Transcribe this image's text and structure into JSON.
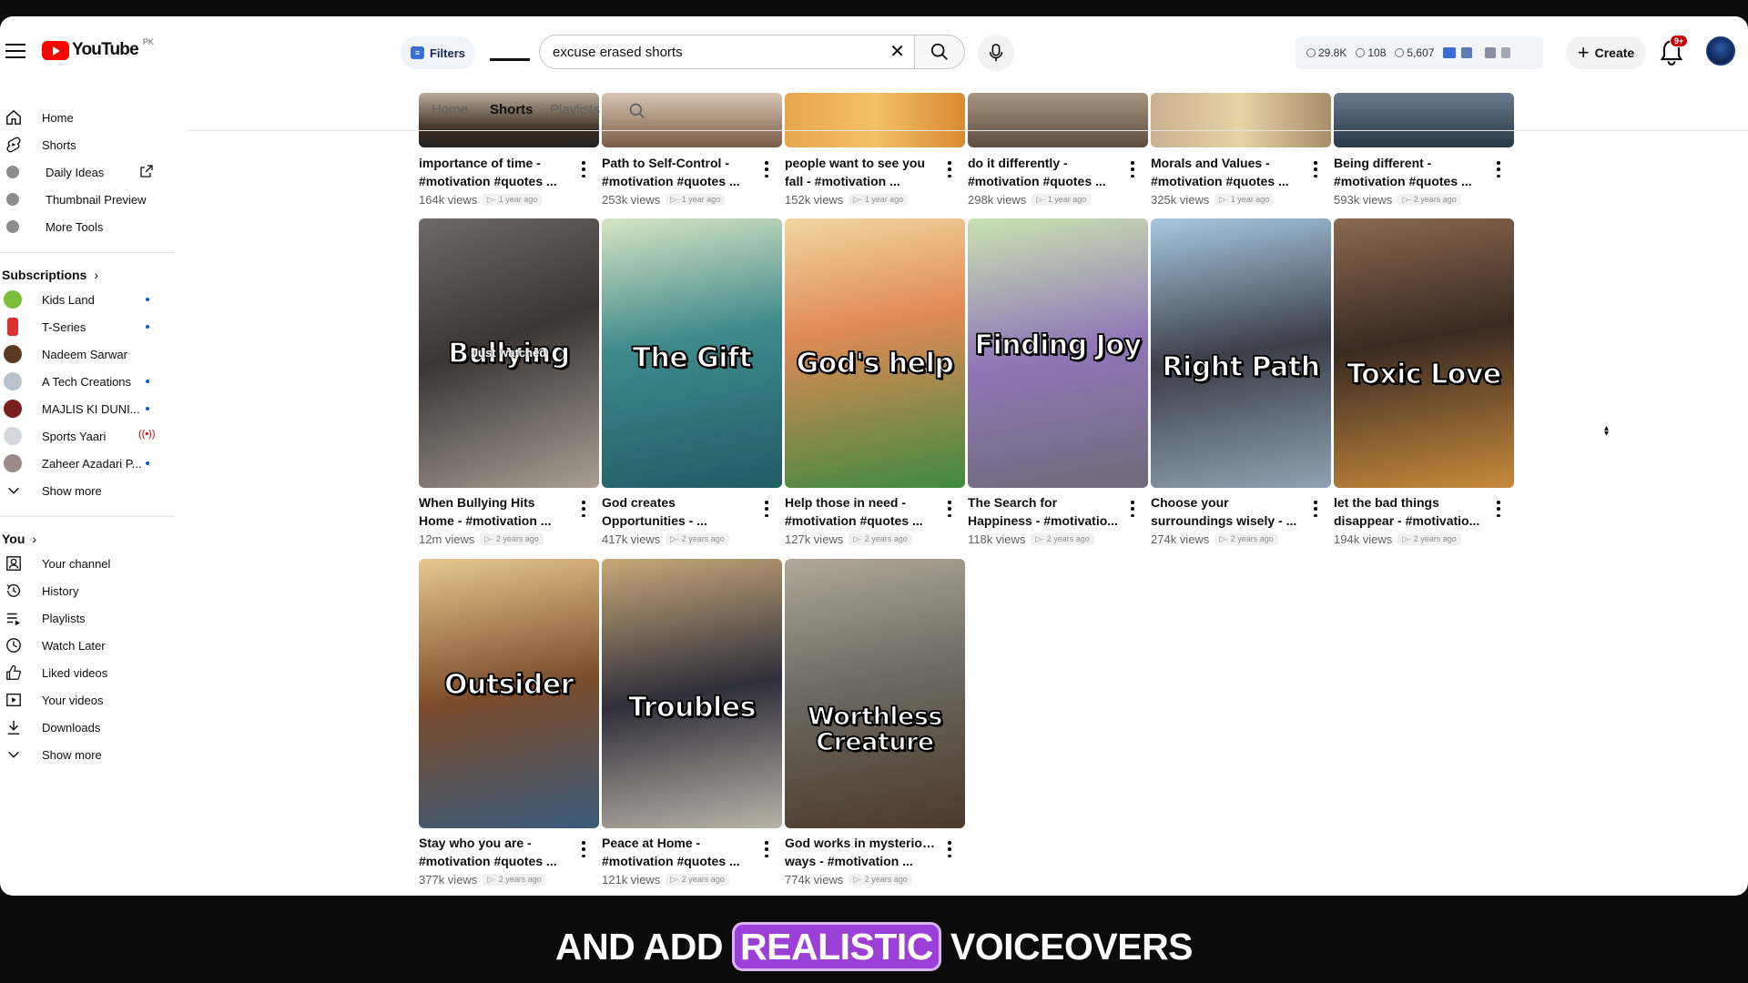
{
  "header": {
    "logo_text": "YouTube",
    "logo_country": "PK",
    "filters_label": "Filters",
    "search_value": "excuse erased shorts",
    "stats": [
      "29.8K",
      "108",
      "5,607"
    ],
    "create_label": "Create",
    "notifications_badge": "9+"
  },
  "sidebar": {
    "main": [
      {
        "label": "Home",
        "icon": "home-icon"
      },
      {
        "label": "Shorts",
        "icon": "shorts-icon"
      },
      {
        "label": "Daily Ideas",
        "icon": "tool-icon"
      },
      {
        "label": "Thumbnail Preview",
        "icon": "tool-icon"
      },
      {
        "label": "More Tools",
        "icon": "tool-icon"
      }
    ],
    "subscriptions_title": "Subscriptions",
    "subscriptions": [
      {
        "label": "Kids Land",
        "color": "#7bbf3a"
      },
      {
        "label": "T-Series",
        "color": "#d93030"
      },
      {
        "label": "Nadeem Sarwar",
        "color": "#5a3b22"
      },
      {
        "label": "A Tech Creations",
        "color": "#b9c2cc"
      },
      {
        "label": "MAJLIS KI DUNI...",
        "color": "#7a1d1d"
      },
      {
        "label": "Sports Yaari",
        "color": "#d4d8de"
      },
      {
        "label": "Zaheer Azadari P...",
        "color": "#9c8a8a"
      }
    ],
    "subs_show_more": "Show more",
    "you_title": "You",
    "you": [
      {
        "label": "Your channel",
        "icon": "channel-icon"
      },
      {
        "label": "History",
        "icon": "history-icon"
      },
      {
        "label": "Playlists",
        "icon": "playlists-icon"
      },
      {
        "label": "Watch Later",
        "icon": "watch-later-icon"
      },
      {
        "label": "Liked videos",
        "icon": "like-icon"
      },
      {
        "label": "Your videos",
        "icon": "your-videos-icon"
      },
      {
        "label": "Downloads",
        "icon": "download-icon"
      }
    ],
    "you_show_more": "Show more"
  },
  "tabs": {
    "home": "Home",
    "shorts": "Shorts",
    "playlists": "Playlists"
  },
  "row1": [
    {
      "title1": "importance of time -",
      "title2": "#motivation #quotes ...",
      "views": "164k views",
      "age": "1 year ago"
    },
    {
      "title1": "Path to Self-Control -",
      "title2": "#motivation #quotes ...",
      "views": "253k views",
      "age": "1 year ago"
    },
    {
      "title1": "people want to see you",
      "title2": "fall - #motivation ...",
      "views": "152k views",
      "age": "1 year ago"
    },
    {
      "title1": "do it differently -",
      "title2": "#motivation #quotes ...",
      "views": "298k views",
      "age": "1 year ago"
    },
    {
      "title1": "Morals and Values -",
      "title2": "#motivation #quotes ...",
      "views": "325k views",
      "age": "1 year ago"
    },
    {
      "title1": "Being different -",
      "title2": "#motivation #quotes ...",
      "views": "593k views",
      "age": "2 years ago"
    }
  ],
  "row2": [
    {
      "thumb_text": "Bullying",
      "overlay": "Just watched",
      "title1": "When Bullying Hits",
      "title2": "Home - #motivation ...",
      "views": "12m views",
      "age": "2 years ago"
    },
    {
      "thumb_text": "The Gift",
      "title1": "God creates",
      "title2": "Opportunities - ...",
      "views": "417k views",
      "age": "2 years ago"
    },
    {
      "thumb_text": "God's help",
      "title1": "Help those in need -",
      "title2": "#motivation #quotes ...",
      "views": "127k views",
      "age": "2 years ago"
    },
    {
      "thumb_text": "Finding Joy",
      "title1": "The Search for",
      "title2": "Happiness - #motivatio...",
      "views": "118k views",
      "age": "2 years ago"
    },
    {
      "thumb_text": "Right Path",
      "title1": "Choose your",
      "title2": "surroundings wisely - ...",
      "views": "274k views",
      "age": "2 years ago"
    },
    {
      "thumb_text": "Toxic Love",
      "title1": "let the bad things",
      "title2": "disappear - #motivatio...",
      "views": "194k views",
      "age": "2 years ago"
    }
  ],
  "row3": [
    {
      "thumb_text": "Outsider",
      "title1": "Stay who you are -",
      "title2": "#motivation #quotes ...",
      "views": "377k views",
      "age": "2 years ago"
    },
    {
      "thumb_text": "Troubles",
      "title1": "Peace at Home -",
      "title2": "#motivation #quotes ...",
      "views": "121k views",
      "age": "2 years ago"
    },
    {
      "thumb_text": "Worthless Creature",
      "title1": "God works in mysterious",
      "title2": "ways - #motivation ...",
      "views": "774k views",
      "age": "2 years ago"
    }
  ],
  "caption": {
    "before": "AND ADD",
    "highlight": "REALISTIC",
    "after": "VOICEOVERS"
  },
  "colors": {
    "brand_red": "#ff0000",
    "caption_highlight": "#9b3fd6",
    "link_blue": "#065fd4"
  }
}
